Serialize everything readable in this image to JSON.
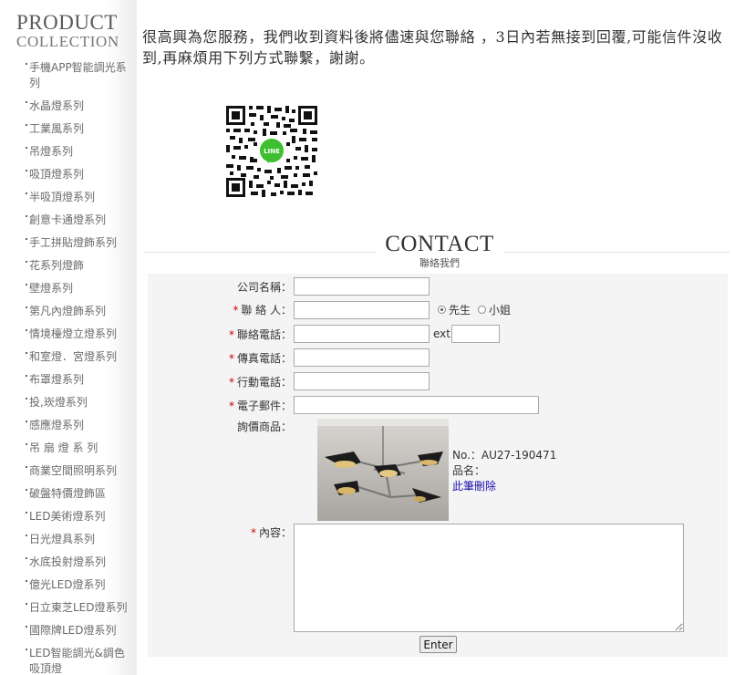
{
  "sidebar": {
    "title": "PRODUCT",
    "subtitle": "COLLECTION",
    "items": [
      {
        "label": "手機APP智能調光系列"
      },
      {
        "label": "水晶燈系列"
      },
      {
        "label": "工業風系列"
      },
      {
        "label": "吊燈系列"
      },
      {
        "label": "吸頂燈系列"
      },
      {
        "label": "半吸頂燈系列"
      },
      {
        "label": "創意卡通燈系列"
      },
      {
        "label": "手工拼貼燈飾系列"
      },
      {
        "label": "花系列燈飾"
      },
      {
        "label": "壁燈系列"
      },
      {
        "label": "第凡內燈飾系列"
      },
      {
        "label": "情境檯燈立燈系列"
      },
      {
        "label": "和室燈．宮燈系列"
      },
      {
        "label": "布罩燈系列"
      },
      {
        "label": "投,崁燈系列"
      },
      {
        "label": "感應燈系列"
      },
      {
        "label": "吊 扇 燈 系 列"
      },
      {
        "label": "商業空間照明系列"
      },
      {
        "label": "破盤特價燈飾區"
      },
      {
        "label": "LED美術燈系列"
      },
      {
        "label": "日光燈具系列"
      },
      {
        "label": "水底投射燈系列"
      },
      {
        "label": "億光LED燈系列"
      },
      {
        "label": "日立東芝LED燈系列"
      },
      {
        "label": "國際牌LED燈系列"
      },
      {
        "label": "LED智能調光&調色吸頂燈"
      }
    ]
  },
  "intro": {
    "text": "很高興為您服務，我們收到資料後將儘速與您聯絡 ，3日內若無接到回覆,可能信件沒收到,再麻煩用下列方式聯繫，謝謝。"
  },
  "qr": {
    "icon": "line-qr-code-icon",
    "badge_label": "LINE"
  },
  "contact": {
    "title": "CONTACT",
    "subtitle": "聯絡我們"
  },
  "form": {
    "company_label": "公司名稱：",
    "company_value": "",
    "required_mark": "*",
    "name_label": "聯 絡 人：",
    "name_value": "",
    "title_mr": "先生",
    "title_ms": "小姐",
    "phone_label": "聯絡電話：",
    "phone_value": "",
    "ext_label": "ext",
    "ext_value": "",
    "fax_label": "傳真電話：",
    "fax_value": "",
    "mobile_label": "行動電話：",
    "mobile_value": "",
    "email_label": "電子郵件：",
    "email_value": "",
    "product_label": "詢價商品：",
    "product_no": "No.：AU27-190471",
    "product_name_label": "品名：",
    "delete_link": "此筆刪除",
    "content_label": "內容：",
    "content_value": "",
    "submit_label": "Enter"
  },
  "colors": {
    "required": "#cc0000",
    "link": "#1a0dab",
    "panel_bg": "#f4f4f4",
    "line_green": "#3dbf2f"
  }
}
